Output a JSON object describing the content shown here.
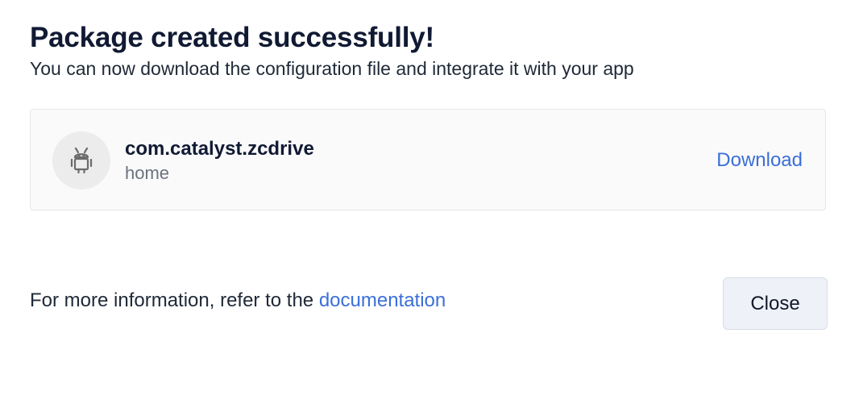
{
  "dialog": {
    "title": "Package created successfully!",
    "subtitle": "You can now download the configuration file and integrate it with your app"
  },
  "package": {
    "icon": "android-icon",
    "name": "com.catalyst.zcdrive",
    "label": "home",
    "download_label": "Download"
  },
  "footer": {
    "info_text": "For more information, refer to the ",
    "doc_link": "documentation",
    "close_label": "Close"
  },
  "colors": {
    "link": "#3b6fd8",
    "title": "#111a33",
    "card_bg": "#fafafa",
    "button_bg": "#eef1f7"
  }
}
